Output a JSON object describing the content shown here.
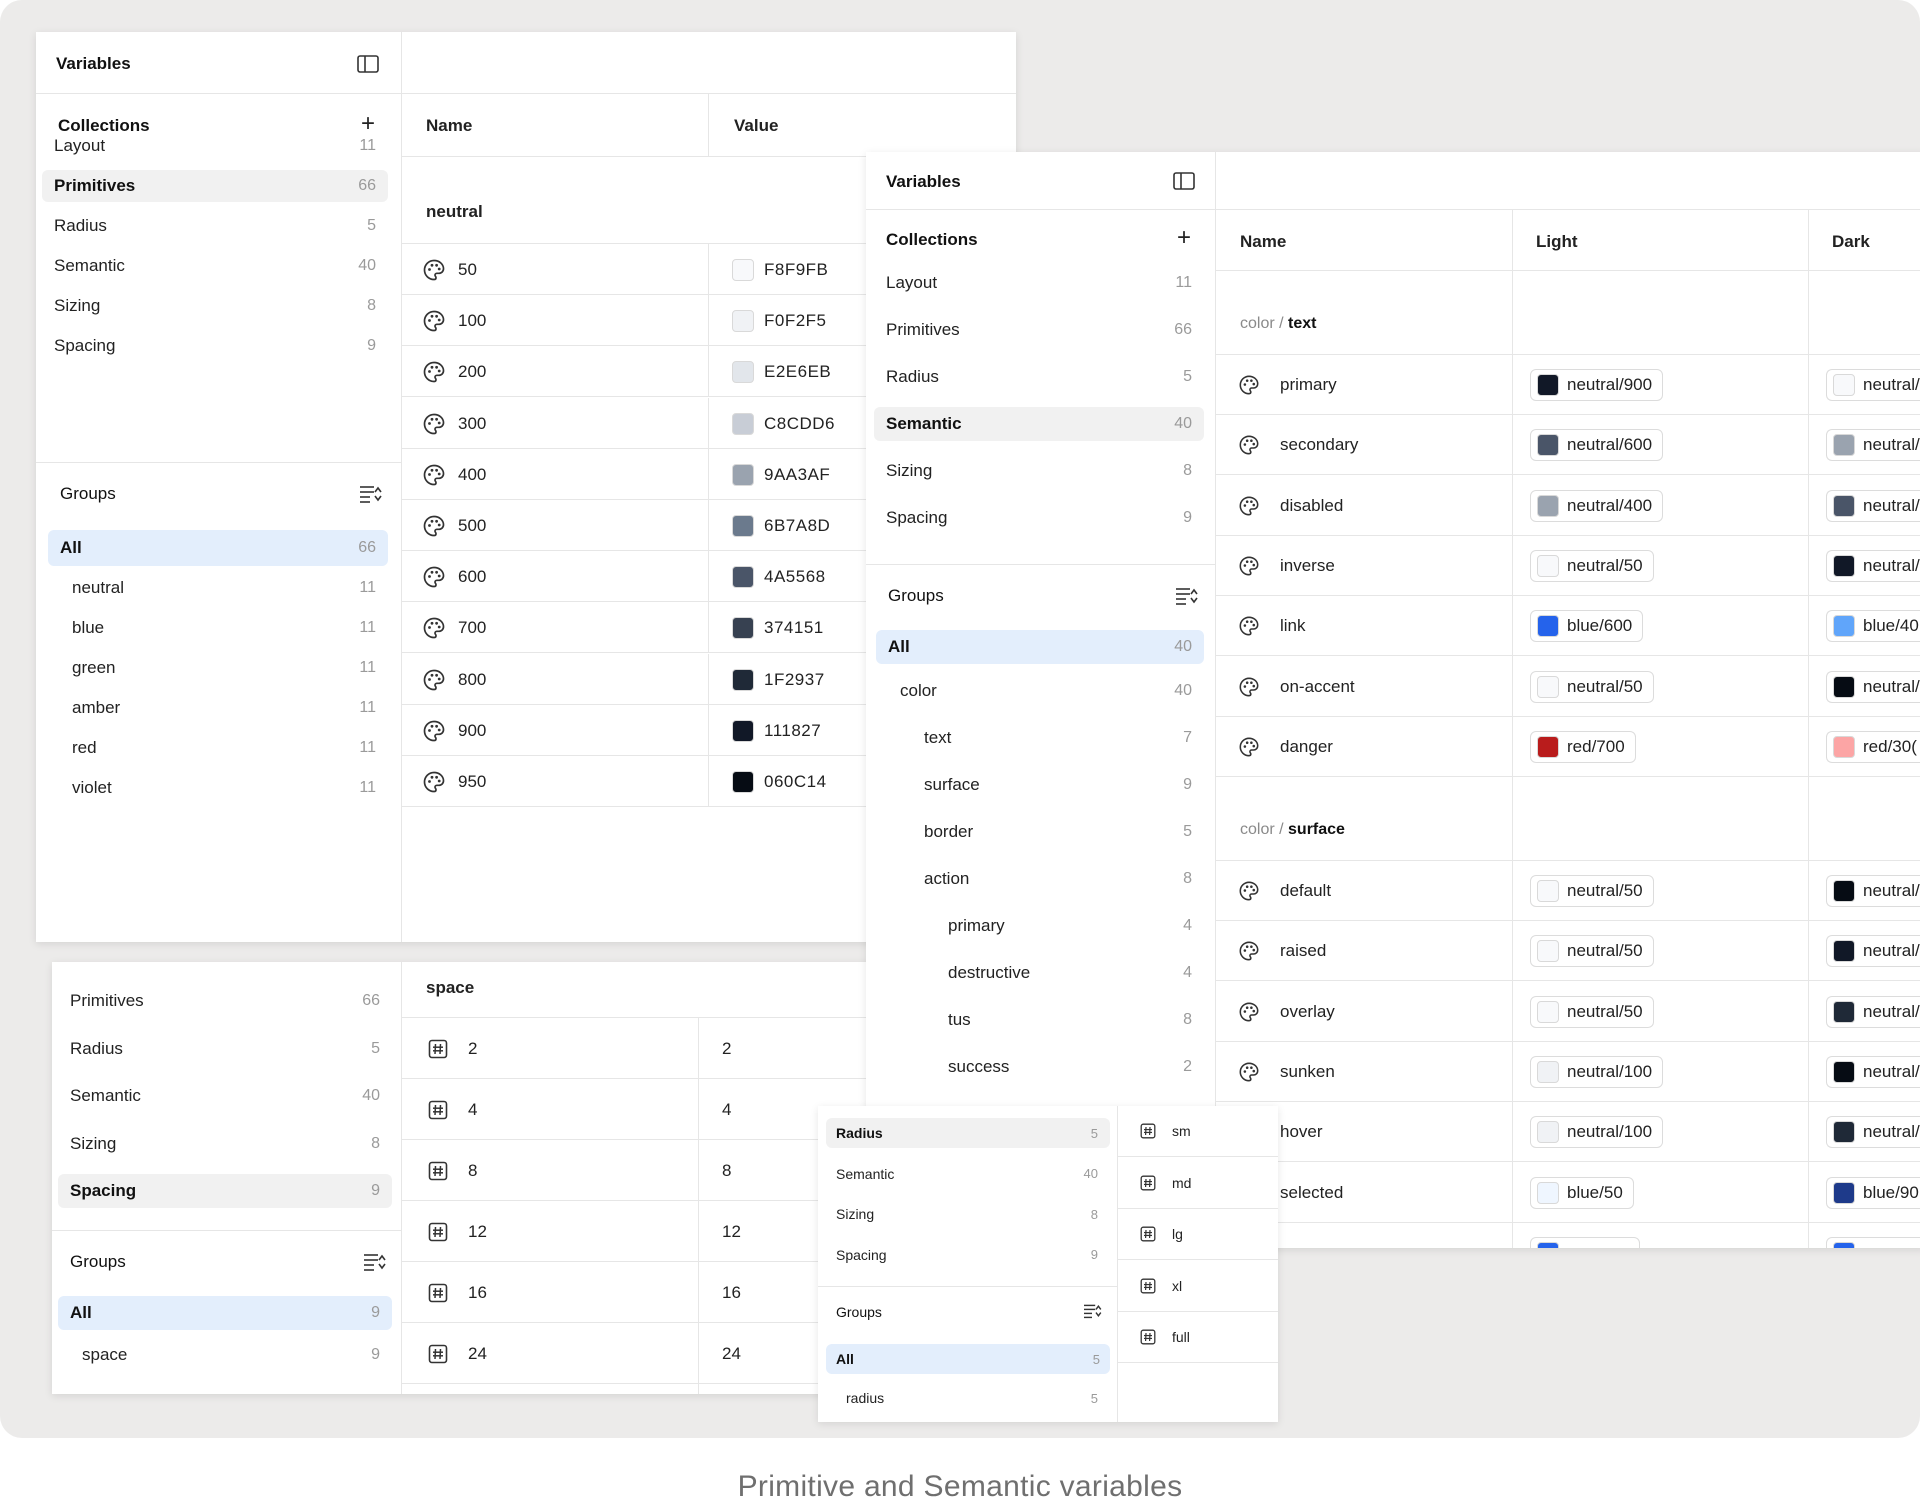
{
  "caption": "Primitive and Semantic variables",
  "common": {
    "variables": "Variables",
    "collections": "Collections",
    "groups": "Groups",
    "name": "Name",
    "value": "Value",
    "light": "Light",
    "dark": "Dark",
    "all": "All"
  },
  "panelA": {
    "collections": [
      {
        "label": "Layout",
        "count": "11"
      },
      {
        "label": "Primitives",
        "count": "66"
      },
      {
        "label": "Radius",
        "count": "5"
      },
      {
        "label": "Semantic",
        "count": "40"
      },
      {
        "label": "Sizing",
        "count": "8"
      },
      {
        "label": "Spacing",
        "count": "9"
      }
    ],
    "all_count": "66",
    "groups": [
      {
        "label": "neutral",
        "count": "11"
      },
      {
        "label": "blue",
        "count": "11"
      },
      {
        "label": "green",
        "count": "11"
      },
      {
        "label": "amber",
        "count": "11"
      },
      {
        "label": "red",
        "count": "11"
      },
      {
        "label": "violet",
        "count": "11"
      }
    ],
    "group_title": "neutral",
    "rows": [
      {
        "name": "50",
        "value": "F8F9FB",
        "color": "#F8F9FB"
      },
      {
        "name": "100",
        "value": "F0F2F5",
        "color": "#F0F2F5"
      },
      {
        "name": "200",
        "value": "E2E6EB",
        "color": "#E2E6EB"
      },
      {
        "name": "300",
        "value": "C8CDD6",
        "color": "#C8CDD6"
      },
      {
        "name": "400",
        "value": "9AA3AF",
        "color": "#9AA3AF"
      },
      {
        "name": "500",
        "value": "6B7A8D",
        "color": "#6B7A8D"
      },
      {
        "name": "600",
        "value": "4A5568",
        "color": "#4A5568"
      },
      {
        "name": "700",
        "value": "374151",
        "color": "#374151"
      },
      {
        "name": "800",
        "value": "1F2937",
        "color": "#1F2937"
      },
      {
        "name": "900",
        "value": "111827",
        "color": "#111827"
      },
      {
        "name": "950",
        "value": "060C14",
        "color": "#060C14"
      }
    ]
  },
  "panelB": {
    "collections": [
      {
        "label": "Layout",
        "count": "11"
      },
      {
        "label": "Primitives",
        "count": "66"
      },
      {
        "label": "Radius",
        "count": "5"
      },
      {
        "label": "Semantic",
        "count": "40"
      },
      {
        "label": "Sizing",
        "count": "8"
      },
      {
        "label": "Spacing",
        "count": "9"
      }
    ],
    "all_count": "40",
    "groups": [
      {
        "label": "color",
        "count": "40"
      },
      {
        "label": "text",
        "count": "7"
      },
      {
        "label": "surface",
        "count": "9"
      },
      {
        "label": "border",
        "count": "5"
      },
      {
        "label": "action",
        "count": "8"
      },
      {
        "label": "primary",
        "count": "4"
      },
      {
        "label": "destructive",
        "count": "4"
      },
      {
        "label": "tus",
        "count": "8"
      },
      {
        "label": "success",
        "count": "2"
      }
    ],
    "section1": {
      "prefix": "color /",
      "name": "text"
    },
    "section2": {
      "prefix": "color /",
      "name": "surface"
    },
    "text_rows": [
      {
        "name": "primary",
        "light": "neutral/900",
        "light_color": "#111827",
        "dark": "neutral/",
        "dark_color": "#F8F9FB"
      },
      {
        "name": "secondary",
        "light": "neutral/600",
        "light_color": "#4A5568",
        "dark": "neutral/",
        "dark_color": "#9AA3AF"
      },
      {
        "name": "disabled",
        "light": "neutral/400",
        "light_color": "#9AA3AF",
        "dark": "neutral/",
        "dark_color": "#4A5568"
      },
      {
        "name": "inverse",
        "light": "neutral/50",
        "light_color": "#F8F9FB",
        "dark": "neutral/",
        "dark_color": "#111827"
      },
      {
        "name": "link",
        "light": "blue/600",
        "light_color": "#2563EB",
        "dark": "blue/40",
        "dark_color": "#60A5FA"
      },
      {
        "name": "on-accent",
        "light": "neutral/50",
        "light_color": "#F8F9FB",
        "dark": "neutral/",
        "dark_color": "#060C14"
      },
      {
        "name": "danger",
        "light": "red/700",
        "light_color": "#B91C1C",
        "dark": "red/30(",
        "dark_color": "#FCA5A5"
      }
    ],
    "surface_rows": [
      {
        "name": "default",
        "light": "neutral/50",
        "light_color": "#F8F9FB",
        "dark": "neutral/",
        "dark_color": "#060C14"
      },
      {
        "name": "raised",
        "light": "neutral/50",
        "light_color": "#F8F9FB",
        "dark": "neutral/",
        "dark_color": "#111827"
      },
      {
        "name": "overlay",
        "light": "neutral/50",
        "light_color": "#F8F9FB",
        "dark": "neutral/",
        "dark_color": "#1F2937"
      },
      {
        "name": "sunken",
        "light": "neutral/100",
        "light_color": "#F0F2F5",
        "dark": "neutral/",
        "dark_color": "#060C14"
      },
      {
        "name": "hover",
        "light": "neutral/100",
        "light_color": "#F0F2F5",
        "dark": "neutral/",
        "dark_color": "#1F2937"
      },
      {
        "name": "selected",
        "light": "blue/50",
        "light_color": "#EFF6FF",
        "dark": "blue/90",
        "dark_color": "#1E3A8A"
      }
    ],
    "partial_row": {
      "light_color": "#2563EB",
      "dark_color": "#2563EB"
    }
  },
  "panelC": {
    "collections": [
      {
        "label": "Primitives",
        "count": "66"
      },
      {
        "label": "Radius",
        "count": "5"
      },
      {
        "label": "Semantic",
        "count": "40"
      },
      {
        "label": "Sizing",
        "count": "8"
      },
      {
        "label": "Spacing",
        "count": "9"
      }
    ],
    "all_count": "9",
    "groups": [
      {
        "label": "space",
        "count": "9"
      }
    ],
    "group_title": "space",
    "rows": [
      {
        "name": "2",
        "value": "2"
      },
      {
        "name": "4",
        "value": "4"
      },
      {
        "name": "8",
        "value": "8"
      },
      {
        "name": "12",
        "value": "12"
      },
      {
        "name": "16",
        "value": "16"
      },
      {
        "name": "24",
        "value": "24"
      }
    ]
  },
  "panelD": {
    "collections": [
      {
        "label": "Radius",
        "count": "5"
      },
      {
        "label": "Semantic",
        "count": "40"
      },
      {
        "label": "Sizing",
        "count": "8"
      },
      {
        "label": "Spacing",
        "count": "9"
      }
    ],
    "all_count": "5",
    "groups": [
      {
        "label": "radius",
        "count": "5"
      }
    ],
    "rows": [
      {
        "name": "sm"
      },
      {
        "name": "md"
      },
      {
        "name": "lg"
      },
      {
        "name": "xl"
      },
      {
        "name": "full"
      }
    ]
  }
}
